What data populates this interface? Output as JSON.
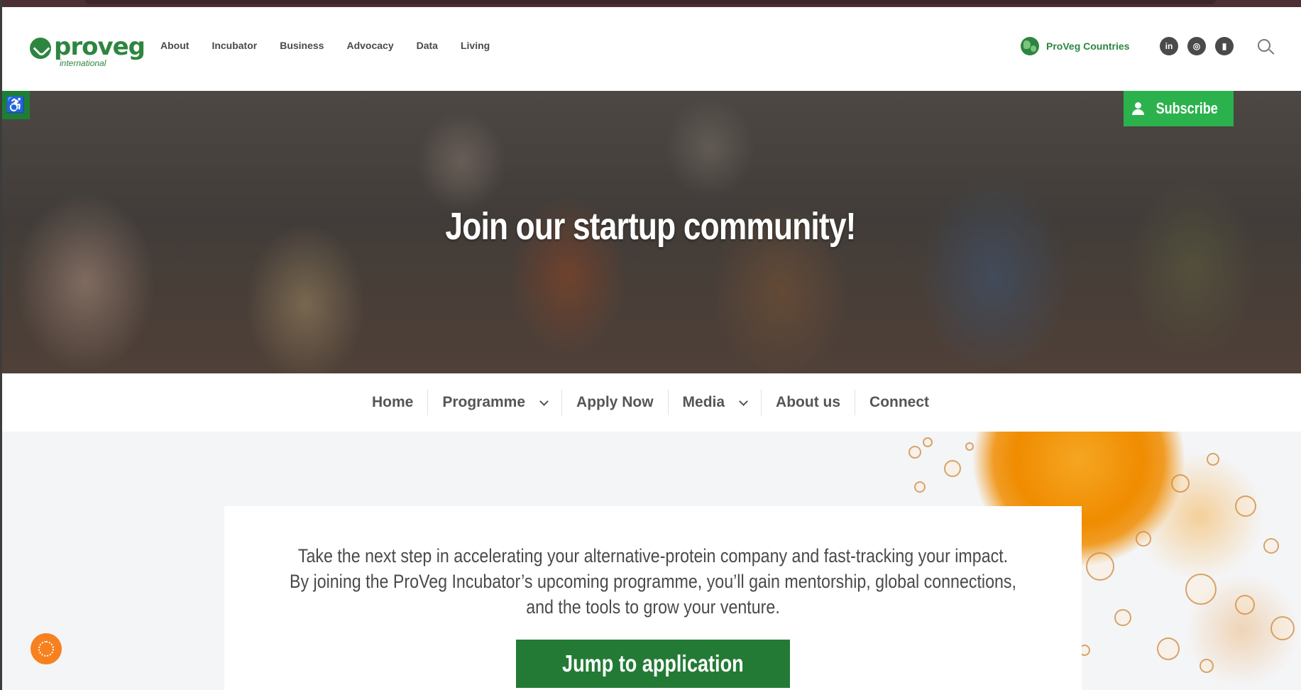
{
  "header": {
    "logo_text": "proveg",
    "logo_subtext": "international",
    "nav": [
      "About",
      "Incubator",
      "Business",
      "Advocacy",
      "Data",
      "Living"
    ],
    "countries_label": "ProVeg Countries",
    "social": [
      {
        "icon": "linkedin-icon",
        "glyph": "in"
      },
      {
        "icon": "instagram-icon",
        "glyph": "◎"
      },
      {
        "icon": "bookmark-icon",
        "glyph": "▮"
      }
    ]
  },
  "hero": {
    "title": "Join our startup community!",
    "subscribe_label": "Subscribe",
    "accessibility_glyph": "♿"
  },
  "subnav": {
    "items": [
      {
        "label": "Home",
        "dropdown": false
      },
      {
        "label": "Programme",
        "dropdown": true
      },
      {
        "label": "Apply Now",
        "dropdown": false
      },
      {
        "label": "Media",
        "dropdown": true
      },
      {
        "label": "About us",
        "dropdown": false
      },
      {
        "label": "Connect",
        "dropdown": false
      }
    ]
  },
  "main": {
    "intro_lines": [
      "Take the next step in accelerating your alternative-protein company and fast-tracking your impact.",
      "By joining the ProVeg Incubator’s upcoming programme, you’ll gain mentorship, global connections,",
      "and the tools to grow your venture."
    ],
    "cta_label": "Jump to application"
  },
  "colors": {
    "brand_green": "#2e8540",
    "subscribe_green": "#2bb24c",
    "cta_green": "#227a35",
    "cookie_orange": "#f7811f"
  }
}
